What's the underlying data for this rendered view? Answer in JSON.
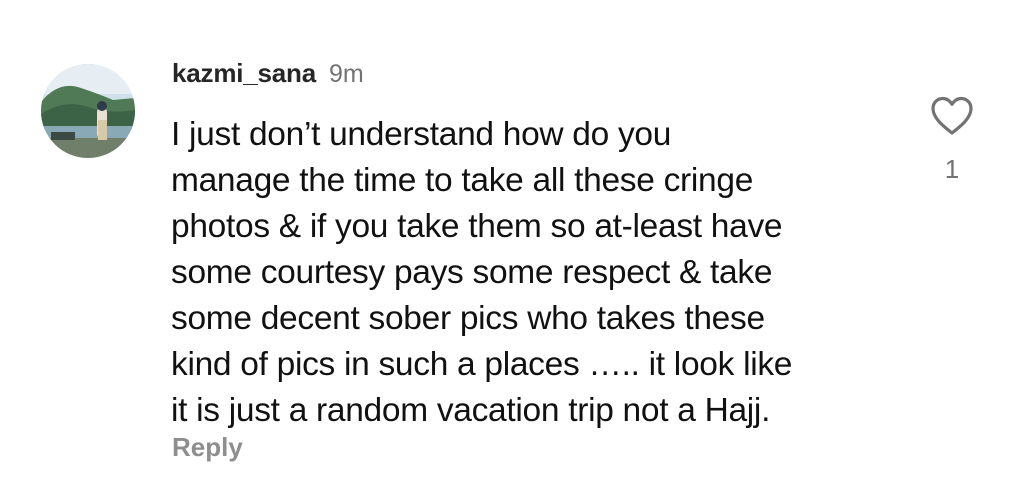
{
  "comment": {
    "username": "kazmi_sana",
    "timestamp": "9m",
    "text": "I just don’t understand how do you\nmanage the time to take all these cringe\nphotos & if you take them so at-least have\nsome courtesy pays some respect & take\nsome decent sober pics who takes these\nkind of pics in such a places ….. it look like\nit is just a random vacation trip not a Hajj.",
    "reply_label": "Reply",
    "like_count": "1",
    "like_icon": "heart-outline-icon",
    "avatar_icon": "profile-photo-landscape"
  },
  "colors": {
    "username": "#262626",
    "secondary_text": "#737373",
    "reply": "#8e8e8e",
    "body_text": "#111111"
  }
}
